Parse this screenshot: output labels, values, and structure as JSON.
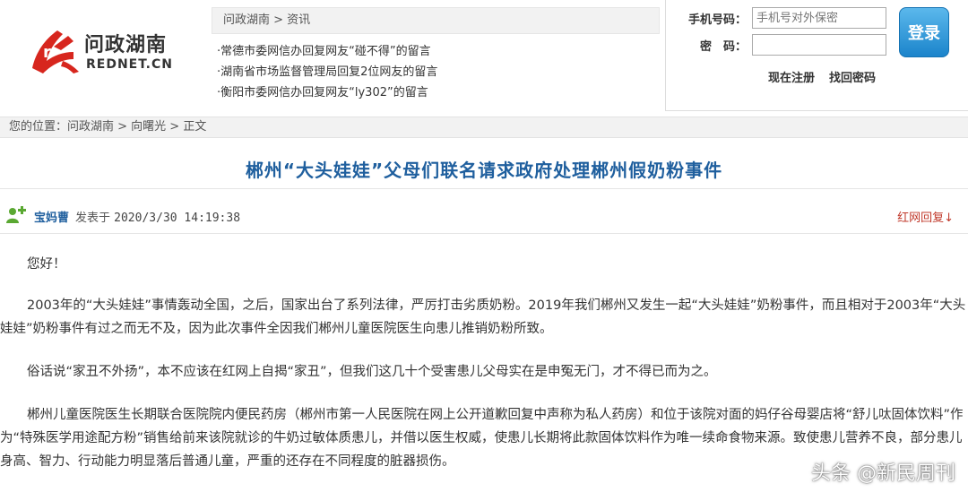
{
  "header": {
    "logo_cn": "问政湖南",
    "logo_en": "REDNET.CN",
    "news_breadcrumb": "问政湖南 > 资讯",
    "news_items": [
      "·常德市委网信办回复网友“碰不得”的留言",
      "·湖南省市场监督管理局回复2位网友的留言",
      "·衡阳市委网信办回复网友“ly302”的留言"
    ]
  },
  "login": {
    "phone_label": "手机号码：",
    "phone_placeholder": "手机号对外保密",
    "password_label": "密　码：",
    "login_button": "登录",
    "register_link": "现在注册",
    "find_password_link": "找回密码"
  },
  "location": "您的位置：问政湖南 > 向曙光 > 正文",
  "article": {
    "title": "郴州“大头娃娃”父母们联名请求政府处理郴州假奶粉事件",
    "author": "宝妈曹",
    "posted_prefix": "发表于",
    "posted_time": "2020/3/30 14:19:38",
    "reply_link": "红网回复↓",
    "paragraphs": [
      "您好！",
      "2003年的“大头娃娃”事情轰动全国，之后，国家出台了系列法律，严厉打击劣质奶粉。2019年我们郴州又发生一起“大头娃娃”奶粉事件，而且相对于2003年“大头娃娃”奶粉事件有过之而无不及，因为此次事件全因我们郴州儿童医院医生向患儿推销奶粉所致。",
      "俗话说“家丑不外扬”，本不应该在红网上自揭“家丑”，但我们这几十个受害患儿父母实在是申冤无门，才不得已而为之。",
      "郴州儿童医院医生长期联合医院院内便民药房（郴州市第一人民医院在网上公开道歉回复中声称为私人药房）和位于该院对面的妈仔谷母婴店将“舒儿呔固体饮料”作为“特殊医学用途配方粉”销售给前来该院就诊的牛奶过敏体质患儿，并借以医生权威，使患儿长期将此款固体饮料作为唯一续命食物来源。致使患儿营养不良，部分患儿身高、智力、行动能力明显落后普通儿童，严重的还存在不同程度的脏器损伤。"
    ]
  },
  "watermark": "头条 @新民周刊",
  "colors": {
    "title_blue": "#1f5f9e",
    "reply_red": "#c0392b",
    "logo_red": "#d7261e",
    "button_blue": "#1b84cb"
  }
}
